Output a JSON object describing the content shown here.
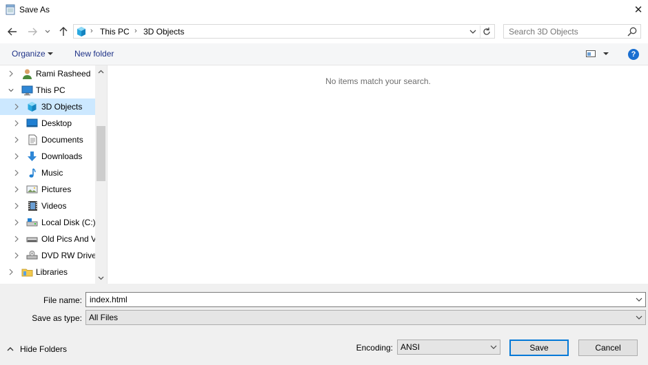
{
  "window": {
    "title": "Save As",
    "close_glyph": "✕"
  },
  "address": {
    "path": [
      "This PC",
      "3D Objects"
    ],
    "separator": "›"
  },
  "search": {
    "placeholder": "Search 3D Objects"
  },
  "toolbar": {
    "organize_label": "Organize",
    "new_folder_label": "New folder",
    "help_glyph": "?"
  },
  "nav": {
    "items": [
      {
        "label": "Rami Rasheed",
        "icon": "user-icon"
      },
      {
        "label": "This PC",
        "icon": "computer-icon",
        "expanded": true
      },
      {
        "label": "3D Objects",
        "icon": "cube-3d-icon",
        "selected": true
      },
      {
        "label": "Desktop",
        "icon": "desktop-icon"
      },
      {
        "label": "Documents",
        "icon": "document-icon"
      },
      {
        "label": "Downloads",
        "icon": "download-icon"
      },
      {
        "label": "Music",
        "icon": "music-icon"
      },
      {
        "label": "Pictures",
        "icon": "pictures-icon"
      },
      {
        "label": "Videos",
        "icon": "video-icon"
      },
      {
        "label": "Local Disk (C:)",
        "icon": "local-disk-icon"
      },
      {
        "label": "Old Pics And V",
        "icon": "drive-icon"
      },
      {
        "label": "DVD RW Drive",
        "icon": "dvd-drive-icon"
      },
      {
        "label": "Libraries",
        "icon": "libraries-icon"
      }
    ]
  },
  "main": {
    "empty_message": "No items match your search."
  },
  "form": {
    "file_name_label": "File name:",
    "file_name_value": "index.html",
    "save_type_label": "Save as type:",
    "save_type_value": "All Files",
    "encoding_label": "Encoding:",
    "encoding_value": "ANSI",
    "save_label": "Save",
    "cancel_label": "Cancel",
    "hide_folders_label": "Hide Folders"
  },
  "colors": {
    "accent": "#0078d7",
    "selection": "#cce8ff",
    "link": "#1e3287",
    "help": "#1a6fd1"
  }
}
